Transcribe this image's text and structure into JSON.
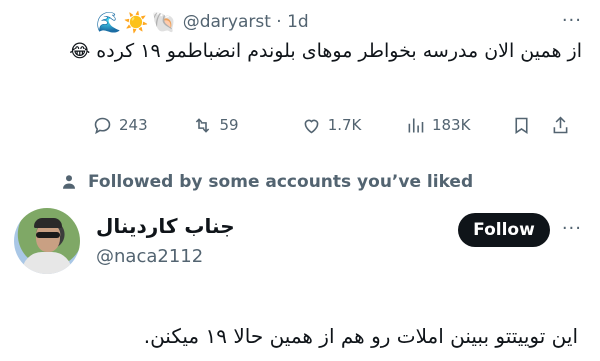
{
  "previous_tweet": {
    "emojis": [
      "🌊",
      "☀️",
      "🐚"
    ],
    "handle_time": "@daryarst · 1d",
    "more": "···",
    "text": "از همین الان مدرسه بخواطر موهای بلوندم انضباطمو ۱۹ کرده",
    "laugh_emoji": "😂",
    "actions": {
      "reply_count": "243",
      "retweet_count": "59",
      "like_count": "1.7K",
      "views_count": "183K"
    }
  },
  "social_context": "Followed by some accounts you’ve liked",
  "tweet": {
    "display_name": "جناب کاردینال",
    "handle": "@naca2112",
    "follow_label": "Follow",
    "more": "···",
    "text": "این توییتتو ببینن املات رو هم از همین حالا ۱۹ میکنن."
  }
}
